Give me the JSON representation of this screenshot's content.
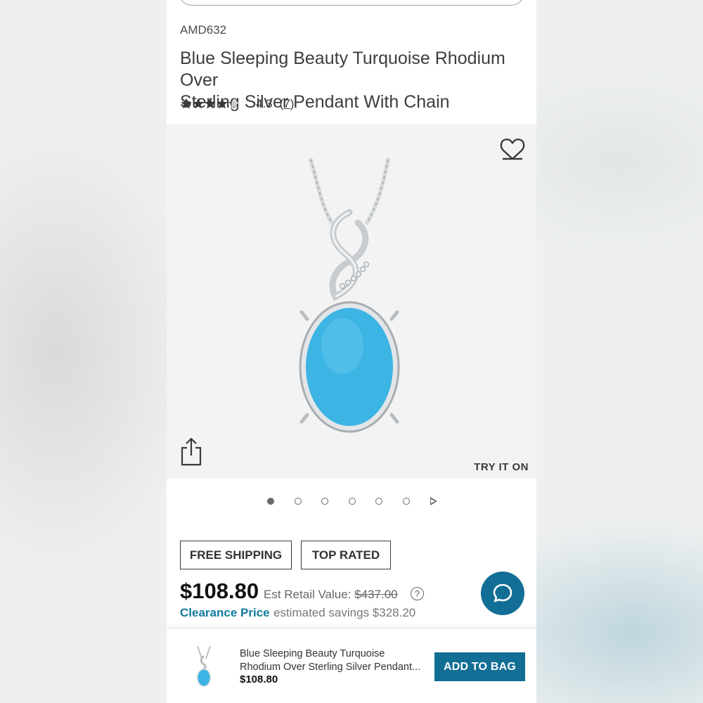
{
  "product": {
    "sku": "AMD632",
    "title": "Blue Sleeping Beauty Turquoise Rhodium Over Sterling Silver Pendant With Chain",
    "rating": 4.3,
    "rating_text": "4.3",
    "review_count": "7",
    "stars_filled": 4.3,
    "stars_total": 5
  },
  "gallery": {
    "try_it_on": "TRY IT ON",
    "image_count": 6,
    "active_index": 0,
    "favorite_icon": "heart-outline-icon",
    "share_icon": "share-icon"
  },
  "badges": [
    "FREE SHIPPING",
    "TOP RATED"
  ],
  "pricing": {
    "price": "$108.80",
    "est_retail_label": "Est Retail Value:",
    "est_retail_value": "$437.00",
    "clearance_label": "Clearance Price",
    "savings_text": "estimated savings $328.20"
  },
  "sticky_bar": {
    "title_line1": "Blue Sleeping Beauty Turquoise",
    "title_line2": "Rhodium Over Sterling Silver Pendant...",
    "price": "$108.80",
    "add_to_bag": "ADD TO BAG"
  },
  "colors": {
    "accent": "#126e94",
    "clearance": "#137a9e",
    "turquoise": "#3cb4e4"
  }
}
